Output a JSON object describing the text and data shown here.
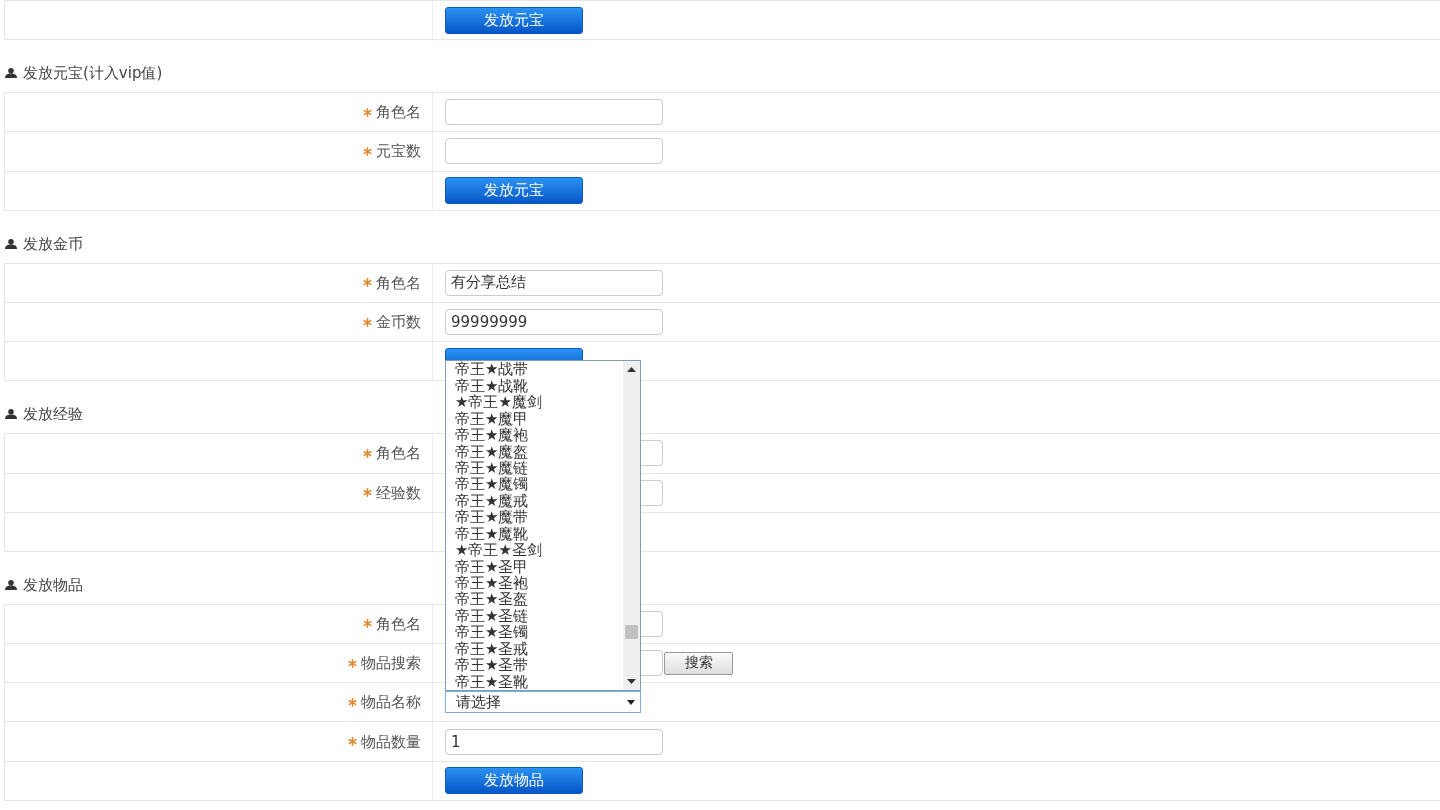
{
  "sections": [
    {
      "rows": [
        {
          "kind": "button",
          "button": "发放元宝"
        }
      ]
    },
    {
      "title": "发放元宝(计入vip值)",
      "rows": [
        {
          "kind": "input",
          "label": "角色名",
          "required": true
        },
        {
          "kind": "input",
          "label": "元宝数",
          "required": true
        },
        {
          "kind": "button",
          "button": "发放元宝"
        }
      ]
    },
    {
      "title": "发放金币",
      "rows": [
        {
          "kind": "input",
          "label": "角色名",
          "required": true,
          "value": "有分享总结"
        },
        {
          "kind": "input",
          "label": "金币数",
          "required": true,
          "value": "99999999"
        },
        {
          "kind": "button"
        }
      ]
    },
    {
      "title": "发放经验",
      "rows": [
        {
          "kind": "input",
          "label": "角色名",
          "required": true
        },
        {
          "kind": "input",
          "label": "经验数",
          "required": true
        },
        {
          "kind": "blank"
        }
      ]
    },
    {
      "title": "发放物品",
      "rows": [
        {
          "kind": "input",
          "label": "角色名",
          "required": true
        },
        {
          "kind": "search",
          "label": "物品搜索",
          "required": true,
          "button": "搜索"
        },
        {
          "kind": "select",
          "label": "物品名称",
          "required": true,
          "value": "请选择",
          "expanded": true,
          "options": [
            {
              "label": "帝王★战带",
              "selected": false
            },
            {
              "label": "帝王★战靴",
              "selected": false
            },
            {
              "label": "★帝王★魔剑",
              "selected": false
            },
            {
              "label": "帝王★魔甲",
              "selected": false
            },
            {
              "label": "帝王★魔袍",
              "selected": false
            },
            {
              "label": "帝王★魔盔",
              "selected": false
            },
            {
              "label": "帝王★魔链",
              "selected": false
            },
            {
              "label": "帝王★魔镯",
              "selected": false
            },
            {
              "label": "帝王★魔戒",
              "selected": false
            },
            {
              "label": "帝王★魔带",
              "selected": false
            },
            {
              "label": "帝王★魔靴",
              "selected": false
            },
            {
              "label": "★帝王★圣剑",
              "selected": false
            },
            {
              "label": "帝王★圣甲",
              "selected": false
            },
            {
              "label": "帝王★圣袍",
              "selected": false
            },
            {
              "label": "帝王★圣盔",
              "selected": false
            },
            {
              "label": "帝王★圣链",
              "selected": false
            },
            {
              "label": "帝王★圣镯",
              "selected": false
            },
            {
              "label": "帝王★圣戒",
              "selected": false
            },
            {
              "label": "帝王★圣带",
              "selected": false
            },
            {
              "label": "帝王★圣靴",
              "selected": false
            }
          ]
        },
        {
          "kind": "input",
          "label": "物品数量",
          "required": true,
          "value": "1"
        },
        {
          "kind": "button",
          "button": "发放物品"
        }
      ]
    }
  ]
}
